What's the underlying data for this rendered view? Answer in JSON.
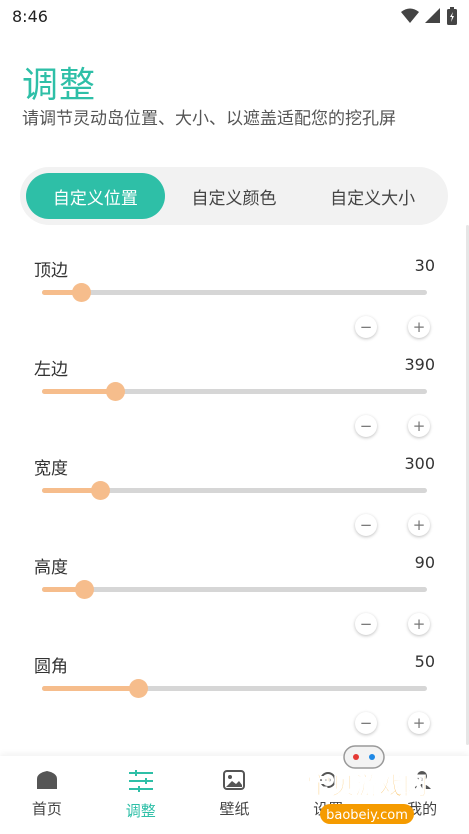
{
  "status": {
    "time": "8:46"
  },
  "header": {
    "title": "调整",
    "subtitle": "请调节灵动岛位置、大小、以遮盖适配您的挖孔屏"
  },
  "tabs": [
    {
      "label": "自定义位置",
      "active": true
    },
    {
      "label": "自定义颜色",
      "active": false
    },
    {
      "label": "自定义大小",
      "active": false
    }
  ],
  "controls": [
    {
      "label": "顶边",
      "value": "30",
      "fraction": 0.1
    },
    {
      "label": "左边",
      "value": "390",
      "fraction": 0.19
    },
    {
      "label": "宽度",
      "value": "300",
      "fraction": 0.15
    },
    {
      "label": "高度",
      "value": "90",
      "fraction": 0.11
    },
    {
      "label": "圆角",
      "value": "50",
      "fraction": 0.25
    }
  ],
  "stepper": {
    "minus": "−",
    "plus": "+"
  },
  "nav": [
    {
      "label": "首页",
      "icon": "home-icon"
    },
    {
      "label": "调整",
      "icon": "sliders-icon",
      "active": true
    },
    {
      "label": "壁纸",
      "icon": "image-icon"
    },
    {
      "label": "设置",
      "icon": "settings-icon"
    },
    {
      "label": "我的",
      "icon": "user-icon"
    }
  ],
  "watermark": {
    "title": "宝贝游戏网",
    "url": "baobeiy.com"
  },
  "colors": {
    "accent": "#2ebfa7",
    "slider": "#f6bd8c",
    "track": "#d6d6d6"
  }
}
